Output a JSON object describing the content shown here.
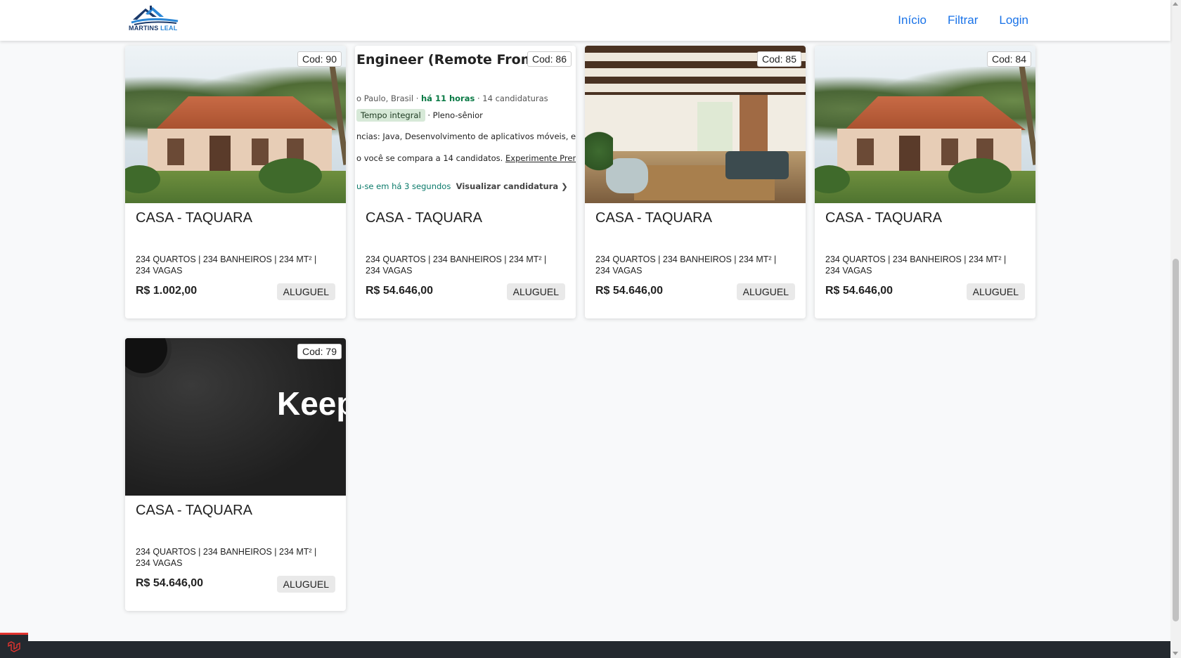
{
  "brand": {
    "logo_word1": "MARTINS",
    "logo_word2": "LEAL",
    "colors": {
      "navy": "#1b3a6b",
      "blue": "#2b87d6"
    }
  },
  "nav": {
    "items": [
      {
        "label": "Início"
      },
      {
        "label": "Filtrar"
      },
      {
        "label": "Login"
      }
    ],
    "link_color": "#1a73e8"
  },
  "properties": [
    {
      "code": "Cod: 90",
      "image": "house-exterior",
      "title": "CASA - TAQUARA",
      "features": "234 QUARTOS | 234 BANHEIROS | 234 MT² | 234 VAGAS",
      "price": "R$ 1.002,00",
      "tag": "ALUGUEL"
    },
    {
      "code": "Cod: 86",
      "image": "job-listing-screenshot",
      "title": "CASA - TAQUARA",
      "features": "234 QUARTOS | 234 BANHEIROS | 234 MT² | 234 VAGAS",
      "price": "R$ 54.646,00",
      "tag": "ALUGUEL",
      "image_text": {
        "title": "Engineer (Remote From re)",
        "location": "o Paulo, Brasil · ",
        "posted": "há 11 horas",
        "applicants": " · 14 candidaturas",
        "pill1": "Tempo integral",
        "level": " · Pleno-sênior",
        "skills": "ncias: Java, Desenvolvimento de aplicativos móveis, e ma",
        "compare": "o você se compara a 14 candidatos. ",
        "premium": "Experimente Premium",
        "applied": "u-se em há 3 segundos",
        "view": "Visualizar candidatura ❯"
      }
    },
    {
      "code": "Cod: 85",
      "image": "living-room-interior",
      "title": "CASA - TAQUARA",
      "features": "234 QUARTOS | 234 BANHEIROS | 234 MT² | 234 VAGAS",
      "price": "R$ 54.646,00",
      "tag": "ALUGUEL"
    },
    {
      "code": "Cod: 84",
      "image": "house-exterior",
      "title": "CASA - TAQUARA",
      "features": "234 QUARTOS | 234 BANHEIROS | 234 MT² | 234 VAGAS",
      "price": "R$ 54.646,00",
      "tag": "ALUGUEL"
    },
    {
      "code": "Cod: 79",
      "image": "dark-keep-graphic",
      "title": "CASA - TAQUARA",
      "features": "234 QUARTOS | 234 BANHEIROS | 234 MT² | 234 VAGAS",
      "price": "R$ 54.646,00",
      "tag": "ALUGUEL",
      "image_text": {
        "word": "Keep"
      }
    }
  ],
  "footer": {
    "badge_icon": "laravel-icon",
    "color": "#24292f"
  }
}
